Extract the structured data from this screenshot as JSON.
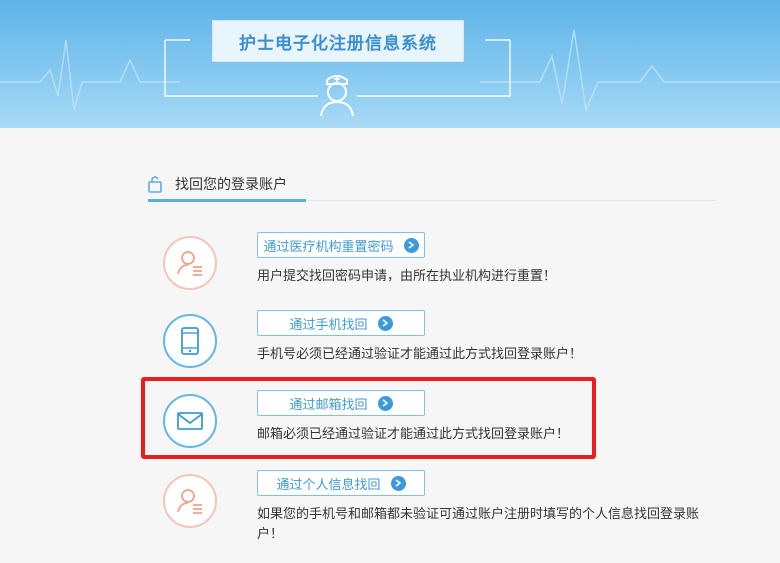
{
  "header": {
    "title": "护士电子化注册信息系统"
  },
  "section": {
    "title": "找回您的登录账户"
  },
  "options": [
    {
      "button_label": "通过医疗机构重置密码",
      "description": "用户提交找回密码申请，由所在执业机构进行重置！",
      "icon": "user-reset-icon"
    },
    {
      "button_label": "通过手机找回",
      "description": "手机号必须已经通过验证才能通过此方式找回登录账户！",
      "icon": "phone-icon"
    },
    {
      "button_label": "通过邮箱找回",
      "description": "邮箱必须已经通过验证才能通过此方式找回登录账户！",
      "icon": "mail-icon"
    },
    {
      "button_label": "通过个人信息找回",
      "description": "如果您的手机号和邮箱都未验证可通过账户注册时填写的个人信息找回登录账户！",
      "icon": "user-info-icon"
    }
  ],
  "colors": {
    "accent": "#3c9ad8",
    "highlight": "#ee1c1c",
    "pink_icon": "#f3a08c"
  }
}
